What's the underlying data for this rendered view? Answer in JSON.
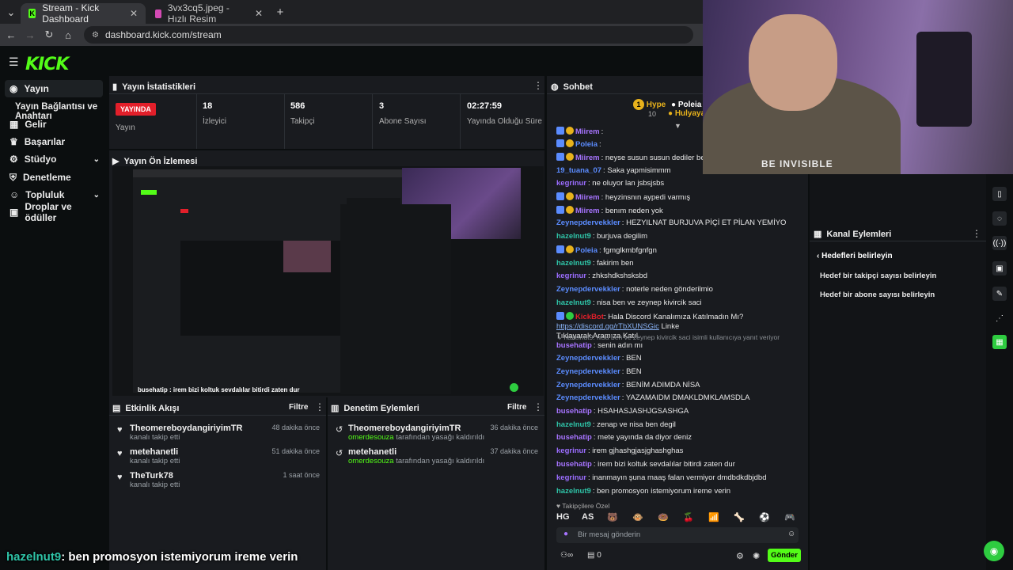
{
  "browser": {
    "tabs": [
      {
        "title": "Stream - Kick Dashboard",
        "active": true
      },
      {
        "title": "3vx3cq5.jpeg - Hızlı Resim",
        "active": false
      }
    ],
    "url": "dashboard.kick.com/stream"
  },
  "brand": {
    "logo": "KICK",
    "accent": "#53fc18",
    "live_color": "#e21f2a"
  },
  "sidebar": {
    "items": [
      {
        "label": "Yayın",
        "icon": "broadcast-icon",
        "active": true
      },
      {
        "label": "Yayın Bağlantısı ve Anahtarı",
        "sub": true
      },
      {
        "label": "Gelir",
        "icon": "money-icon"
      },
      {
        "label": "Başarılar",
        "icon": "trophy-icon"
      },
      {
        "label": "Stüdyo",
        "icon": "studio-icon",
        "expandable": true
      },
      {
        "label": "Denetleme",
        "icon": "shield-icon"
      },
      {
        "label": "Topluluk",
        "icon": "people-icon",
        "expandable": true
      },
      {
        "label": "Droplar ve ödüller",
        "icon": "gift-icon"
      }
    ]
  },
  "stats": {
    "title": "Yayın İstatistikleri",
    "live_badge": "YAYINDA",
    "status_label": "Yayın",
    "items": [
      {
        "value": "18",
        "label": "İzleyici"
      },
      {
        "value": "586",
        "label": "Takipçi"
      },
      {
        "value": "3",
        "label": "Abone Sayısı"
      },
      {
        "value": "02:27:59",
        "label": "Yayında Olduğu Süre"
      }
    ]
  },
  "preview": {
    "title": "Yayın Ön İzlemesi",
    "overlay_caption": "busehatip : irem bizi koltuk sevdalılar bitirdi zaten dur"
  },
  "activity": {
    "title": "Etkinlik Akışı",
    "filter": "Filtre",
    "items": [
      {
        "name": "TheomereboydangiriyimTR",
        "sub": "kanalı takip etti",
        "time": "48 dakika önce"
      },
      {
        "name": "metehanetli",
        "sub": "kanalı takip etti",
        "time": "51 dakika önce"
      },
      {
        "name": "TheTurk78",
        "sub": "kanalı takip etti",
        "time": "1 saat önce"
      }
    ]
  },
  "moderation": {
    "title": "Denetim Eylemleri",
    "filter": "Filtre",
    "items": [
      {
        "name": "TheomereboydangiriyimTR",
        "actor": "omerdesouza",
        "sub": "tarafından yasağı kaldırıldı",
        "time": "36 dakika önce"
      },
      {
        "name": "metehanetli",
        "actor": "omerdesouza",
        "sub": "tarafından yasağı kaldırıldı",
        "time": "37 dakika önce"
      }
    ]
  },
  "chat": {
    "title": "Sohbet",
    "top_gifters": [
      {
        "name": "Hype",
        "count": "10"
      },
      {
        "name": "Poleia",
        "count": ""
      },
      {
        "name": "Hulyayar",
        "count": ""
      }
    ],
    "messages": [
      {
        "user": "Miirem",
        "color": "c-purple",
        "text": "",
        "badges": 2
      },
      {
        "user": "Poleia",
        "color": "c-blue",
        "text": "",
        "badges": 2
      },
      {
        "user": "Miirem",
        "color": "c-purple",
        "text": "neyse susun susun dediler ben gelince",
        "badges": 2
      },
      {
        "user": "19_tuana_07",
        "color": "c-blue",
        "text": "Saka yapmisimmm",
        "badges": 0
      },
      {
        "user": "kegrinur",
        "color": "c-violet",
        "text": "ne oluyor lan jsbsjsbs",
        "badges": 0
      },
      {
        "user": "Miirem",
        "color": "c-purple",
        "text": "heyzinsnın aypedi varmış",
        "badges": 2
      },
      {
        "user": "Miirem",
        "color": "c-purple",
        "text": "benım neden yok",
        "badges": 2
      },
      {
        "user": "Zeynepdervekkler",
        "color": "c-blue",
        "text": "HEZYILNAT BURJUVA PİÇİ ET PİLAN YEMİYO",
        "badges": 0
      },
      {
        "user": "hazelnut9",
        "color": "c-teal",
        "text": "burjuva degilim",
        "badges": 0
      },
      {
        "user": "Poleia",
        "color": "c-blue",
        "text": "fgmglkmbfgnfgn",
        "badges": 2
      },
      {
        "user": "hazelnut9",
        "color": "c-teal",
        "text": "fakirim ben",
        "badges": 0
      },
      {
        "user": "kegrinur",
        "color": "c-violet",
        "text": "zhkshdkshsksbd",
        "badges": 0
      },
      {
        "user": "Zeynepdervekkler",
        "color": "c-blue",
        "text": "noterle neden gönderilmio",
        "badges": 0
      },
      {
        "user": "hazelnut9",
        "color": "c-teal",
        "text": "nisa ben ve zeynep kivircik saci",
        "badges": 0
      }
    ],
    "bot": {
      "user": "KickBot",
      "text": "Hala Discord Kanalımıza Katılmadın Mı?",
      "link": "https://discord.gg/rTbXUNSGic",
      "text2": "Linke",
      "text3": "Tıklayarak Aramıza Katıl."
    },
    "reply_hint": "hazelnut9: nisa ben ve zeynep kivircik saci isimli kullanıcıya yanıt veriyor",
    "messages2": [
      {
        "user": "busehatip",
        "color": "c-purple",
        "text": "senin adın mı"
      },
      {
        "user": "Zeynepdervekkler",
        "color": "c-blue",
        "text": "BEN"
      },
      {
        "user": "Zeynepdervekkler",
        "color": "c-blue",
        "text": "BEN"
      },
      {
        "user": "Zeynepdervekkler",
        "color": "c-blue",
        "text": "BENİM ADIMDA NİSA"
      },
      {
        "user": "Zeynepdervekkler",
        "color": "c-blue",
        "text": "YAZAMAIDM DMAKLDMKLAMSDLA"
      },
      {
        "user": "busehatip",
        "color": "c-purple",
        "text": "HSAHASJASHJGSASHGA"
      },
      {
        "user": "hazelnut9",
        "color": "c-teal",
        "text": "zenap ve nisa ben degil"
      },
      {
        "user": "busehatip",
        "color": "c-purple",
        "text": "mete yayında da diyor deniz"
      },
      {
        "user": "kegrinur",
        "color": "c-violet",
        "text": "irem gjhashgjasjghashghas"
      },
      {
        "user": "busehatip",
        "color": "c-purple",
        "text": "irem bizi koltuk sevdalılar bitirdi zaten dur"
      },
      {
        "user": "kegrinur",
        "color": "c-violet",
        "text": "inanmayın şuna maaş falan vermiyor dmdbdkdbjdbd"
      },
      {
        "user": "hazelnut9",
        "color": "c-teal",
        "text": "ben promosyon istemiyorum ireme verin"
      }
    ],
    "followers_only": "Takipçilere Özel",
    "emotes": [
      "HG",
      "AS",
      "🐻",
      "🐵",
      "🍩",
      "🍒",
      "📶",
      "🦴",
      "⚽",
      "🎮"
    ],
    "input_placeholder": "Bir mesaj gönderin",
    "send_label": "Gönder",
    "footer_count": "0"
  },
  "channel_actions": {
    "title": "Kanal Eylemleri",
    "sub_title": "Hedefleri belirleyin",
    "items": [
      "Hedef bir takipçi sayısı belirleyin",
      "Hedef bir abone sayısı belirleyin"
    ]
  },
  "webcam_text": "BE INVISIBLE",
  "overlay_caption": {
    "user": "hazelnut9",
    "text": ": ben promosyon istemiyorum ireme verin"
  }
}
